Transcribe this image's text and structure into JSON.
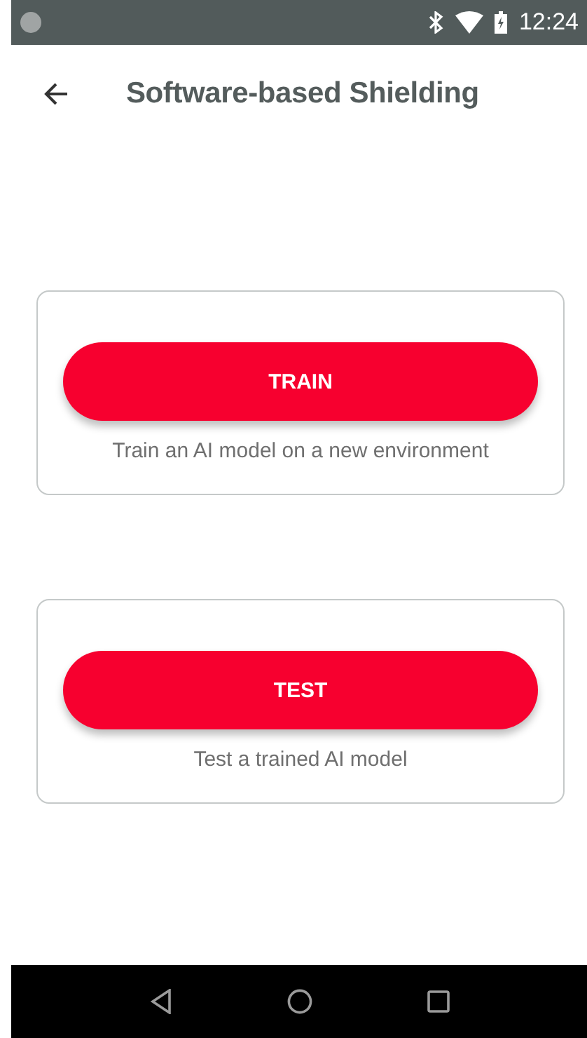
{
  "status_bar": {
    "time": "12:24"
  },
  "app_bar": {
    "title": "Software-based Shielding"
  },
  "cards": [
    {
      "button": "TRAIN",
      "description": "Train an AI model on a new environment"
    },
    {
      "button": "TEST",
      "description": "Test a trained AI model"
    }
  ]
}
